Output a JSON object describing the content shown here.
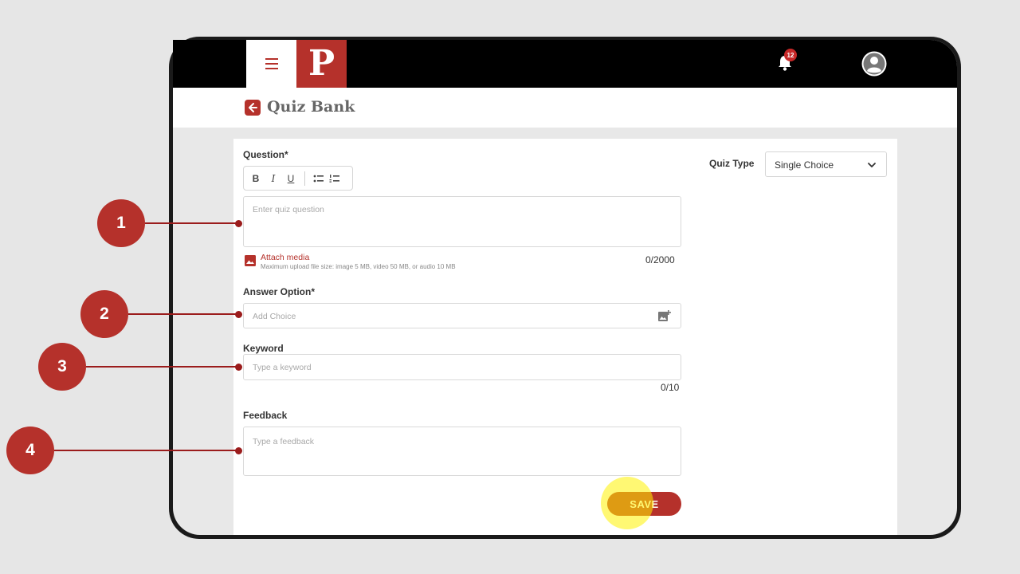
{
  "app": {
    "logo_letter": "P",
    "notification_count": "12",
    "page_title": "Quiz Bank"
  },
  "form": {
    "question_label": "Question*",
    "toolbar": {
      "bold": "B",
      "italic": "I",
      "underline": "U"
    },
    "question_placeholder": "Enter quiz question",
    "attach_label": "Attach media",
    "attach_hint": "Maximum upload file size: image 5 MB, video 50 MB, or audio 10 MB",
    "question_counter": "0/2000",
    "answer_label": "Answer Option*",
    "answer_placeholder": "Add Choice",
    "keyword_label": "Keyword",
    "keyword_placeholder": "Type a keyword",
    "keyword_counter": "0/10",
    "feedback_label": "Feedback",
    "feedback_placeholder": "Type a feedback",
    "save_label": "SAVE"
  },
  "quiz_type": {
    "label": "Quiz Type",
    "selected": "Single Choice"
  },
  "callouts": [
    "1",
    "2",
    "3",
    "4"
  ],
  "colors": {
    "brand_red": "#b5312b",
    "highlight": "#fff200"
  }
}
